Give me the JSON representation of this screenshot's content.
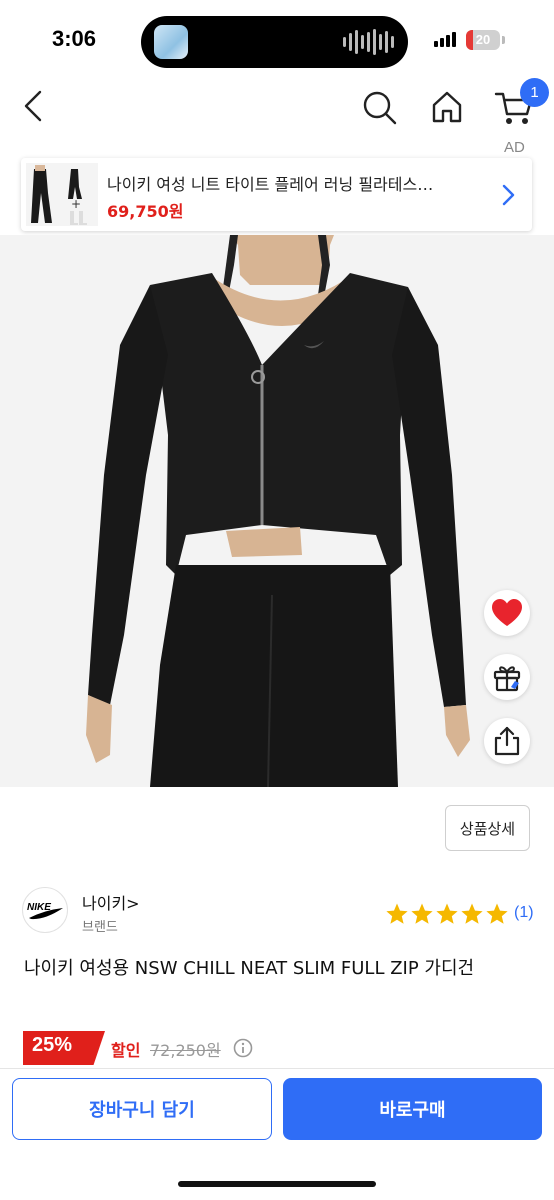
{
  "status_bar": {
    "time": "3:06",
    "battery_level": "20",
    "battery_fraction": 0.2,
    "battery_color": "#e53935"
  },
  "nav": {
    "icons": [
      "chevron-left-icon",
      "search-icon",
      "home-icon",
      "cart-icon"
    ],
    "cart_badge": "1"
  },
  "ad": {
    "label": "AD",
    "title": "나이키 여성 니트 타이트 플레어 러닝 필라테스…",
    "price": "69,750원"
  },
  "actions": {
    "icons": [
      "heart-icon",
      "gift-icon",
      "share-icon"
    ],
    "heart_color": "#e8242d"
  },
  "detail_button": "상품상세",
  "brand": {
    "logo": "NIKE",
    "name": "나이키>",
    "subtitle": "브랜드",
    "rating_stars": 5,
    "review_count": "(1)"
  },
  "product": {
    "title": "나이키 여성용 NSW CHILL NEAT SLIM FULL ZIP 가디건"
  },
  "price": {
    "discount": "25%",
    "sale_label": "할인",
    "original_price": "72,250원"
  },
  "bottom": {
    "cart_button": "장바구니 담기",
    "buy_button": "바로구매"
  },
  "colors": {
    "accent": "#2f6df6",
    "sale": "#e0201b",
    "star": "#f5b800"
  }
}
